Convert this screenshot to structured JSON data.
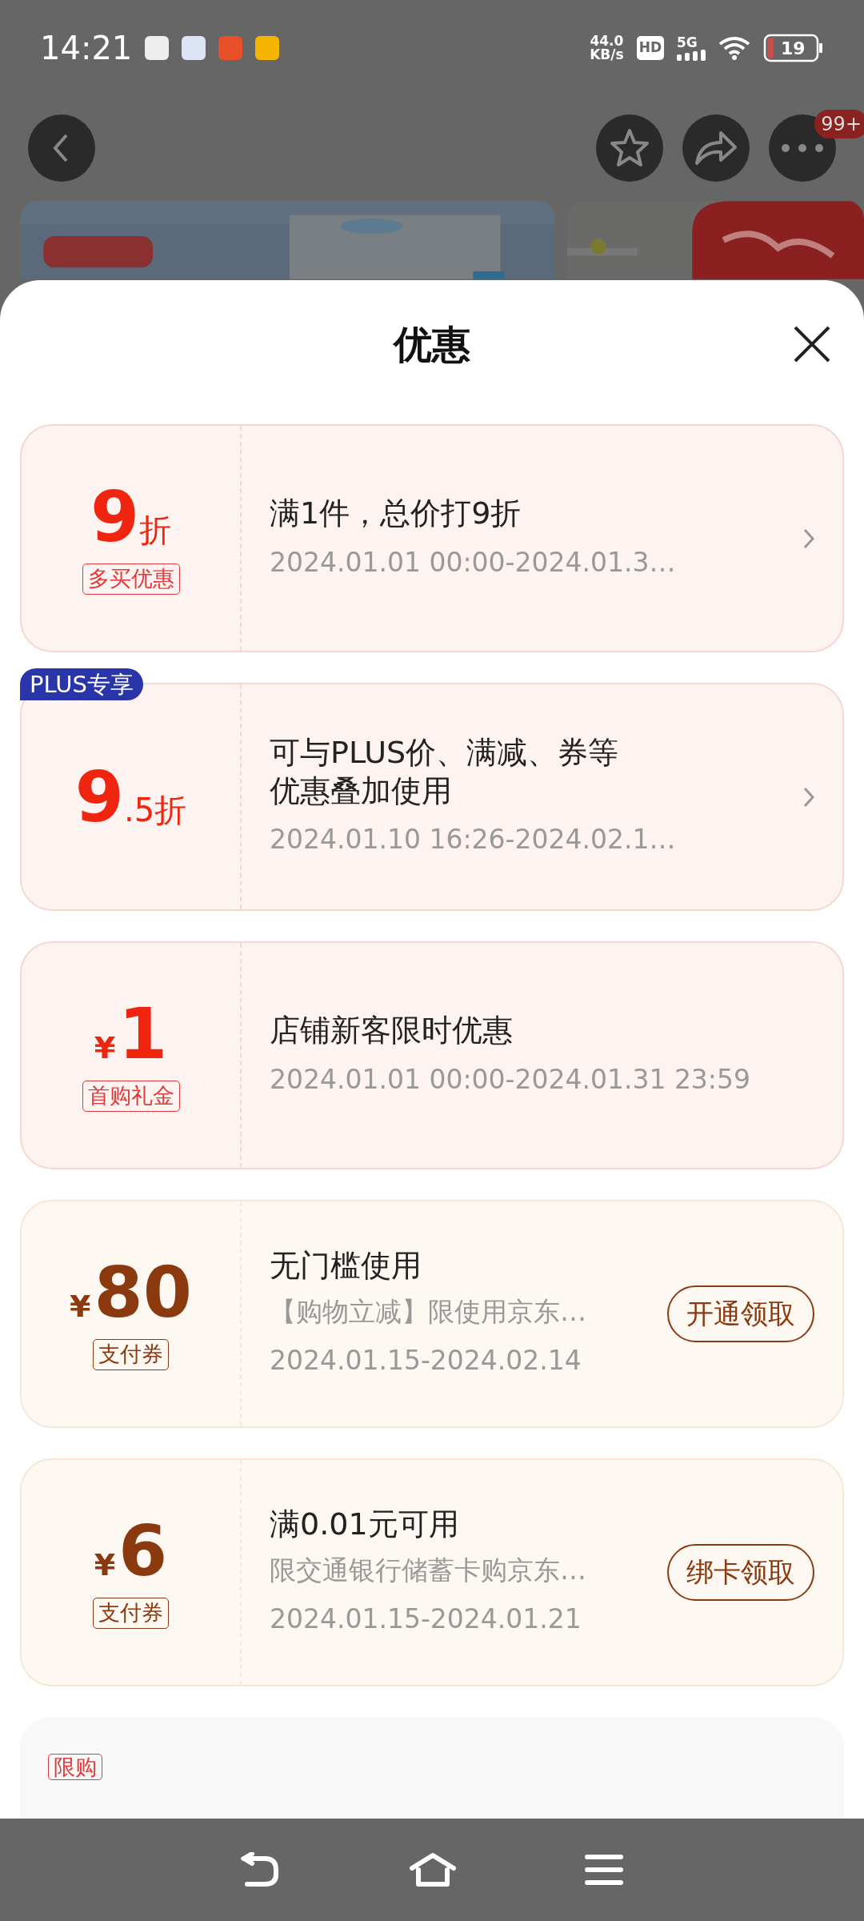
{
  "status_bar": {
    "time": "14:21",
    "speed": "44.0",
    "speed_unit": "KB/s",
    "hd": "HD",
    "network": "5G",
    "battery": "19"
  },
  "header": {
    "more_badge": "99+"
  },
  "sheet": {
    "title": "优惠"
  },
  "offers": [
    {
      "kind": "promo",
      "chevron": true,
      "amount": "9",
      "amount_suffix": "折",
      "tag": "多买优惠",
      "title": "满1件，总价打9折",
      "period": "2024.01.01 00:00-2024.01.3…"
    },
    {
      "kind": "promo",
      "chevron": true,
      "ribbon": "PLUS专享",
      "amount": "9",
      "amount_suffix": ".5折",
      "title": "可与PLUS价、满减、券等优惠叠加使用",
      "period": "2024.01.10 16:26-2024.02.1…"
    },
    {
      "kind": "promo",
      "chevron": false,
      "amount_prefix": "¥",
      "amount": "1",
      "tag": "首购礼金",
      "title": "店铺新客限时优惠",
      "period": "2024.01.01 00:00-2024.01.31 23:59"
    },
    {
      "kind": "payment",
      "chevron": false,
      "button": "开通领取",
      "amount_prefix": "¥",
      "amount": "80",
      "tag": "支付券",
      "title": "无门槛使用",
      "subtitle": "【购物立减】限使用京东…",
      "period": "2024.01.15-2024.02.14"
    },
    {
      "kind": "payment",
      "chevron": false,
      "button": "绑卡领取",
      "amount_prefix": "¥",
      "amount": "6",
      "tag": "支付券",
      "title": "满0.01元可用",
      "subtitle": "限交通银行储蓄卡购京东…",
      "period": "2024.01.15-2024.01.21"
    }
  ],
  "limited": {
    "tag": "限购"
  }
}
